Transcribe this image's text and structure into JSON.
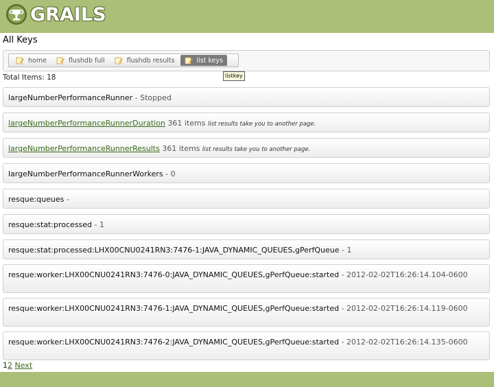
{
  "header": {
    "logo_text": "GRAILS",
    "brand_color": "#abbf78",
    "logo_icon": "grails-cup-icon"
  },
  "page": {
    "title": "All Keys"
  },
  "nav": {
    "items": [
      {
        "label": "home",
        "icon": "edit-icon",
        "active": false
      },
      {
        "label": "flushdb full",
        "icon": "edit-icon",
        "active": false
      },
      {
        "label": "flushdb results",
        "icon": "edit-icon",
        "active": false
      },
      {
        "label": "list keys",
        "icon": "edit-icon",
        "active": true
      }
    ],
    "tooltip": "listkey"
  },
  "total_label": "Total Items: 18",
  "rows": [
    {
      "key": "largeNumberPerformanceRunner",
      "rest": " - Stopped",
      "note": "",
      "link": false
    },
    {
      "key": "largeNumberPerformanceRunnerDuration",
      "rest": " 361 items ",
      "note": "list results take you to another page.",
      "link": true
    },
    {
      "key": "largeNumberPerformanceRunnerResults",
      "rest": " 361 items ",
      "note": "list results take you to another page.",
      "link": true
    },
    {
      "key": "largeNumberPerformanceRunnerWorkers",
      "rest": " - 0",
      "note": "",
      "link": false
    },
    {
      "key": "resque:queues",
      "rest": " -",
      "note": "",
      "link": false
    },
    {
      "key": "resque:stat:processed",
      "rest": " - 1",
      "note": "",
      "link": false
    },
    {
      "key": "resque:stat:processed:LHX00CNU0241RN3:7476-1:JAVA_DYNAMIC_QUEUES,gPerfQueue",
      "rest": " - 1",
      "note": "",
      "link": false
    },
    {
      "key": "resque:worker:LHX00CNU0241RN3:7476-0:JAVA_DYNAMIC_QUEUES,gPerfQueue:started",
      "rest": " - 2012-02-02T16:26:14.104-0600",
      "note": "",
      "link": false
    },
    {
      "key": "resque:worker:LHX00CNU0241RN3:7476-1:JAVA_DYNAMIC_QUEUES,gPerfQueue:started",
      "rest": " - 2012-02-02T16:26:14.119-0600",
      "note": "",
      "link": false
    },
    {
      "key": "resque:worker:LHX00CNU0241RN3:7476-2:JAVA_DYNAMIC_QUEUES,gPerfQueue:started",
      "rest": " - 2012-02-02T16:26:14.135-0600",
      "note": "",
      "link": false
    }
  ],
  "pager": {
    "page1": "1",
    "page2": "2",
    "next": "Next"
  }
}
